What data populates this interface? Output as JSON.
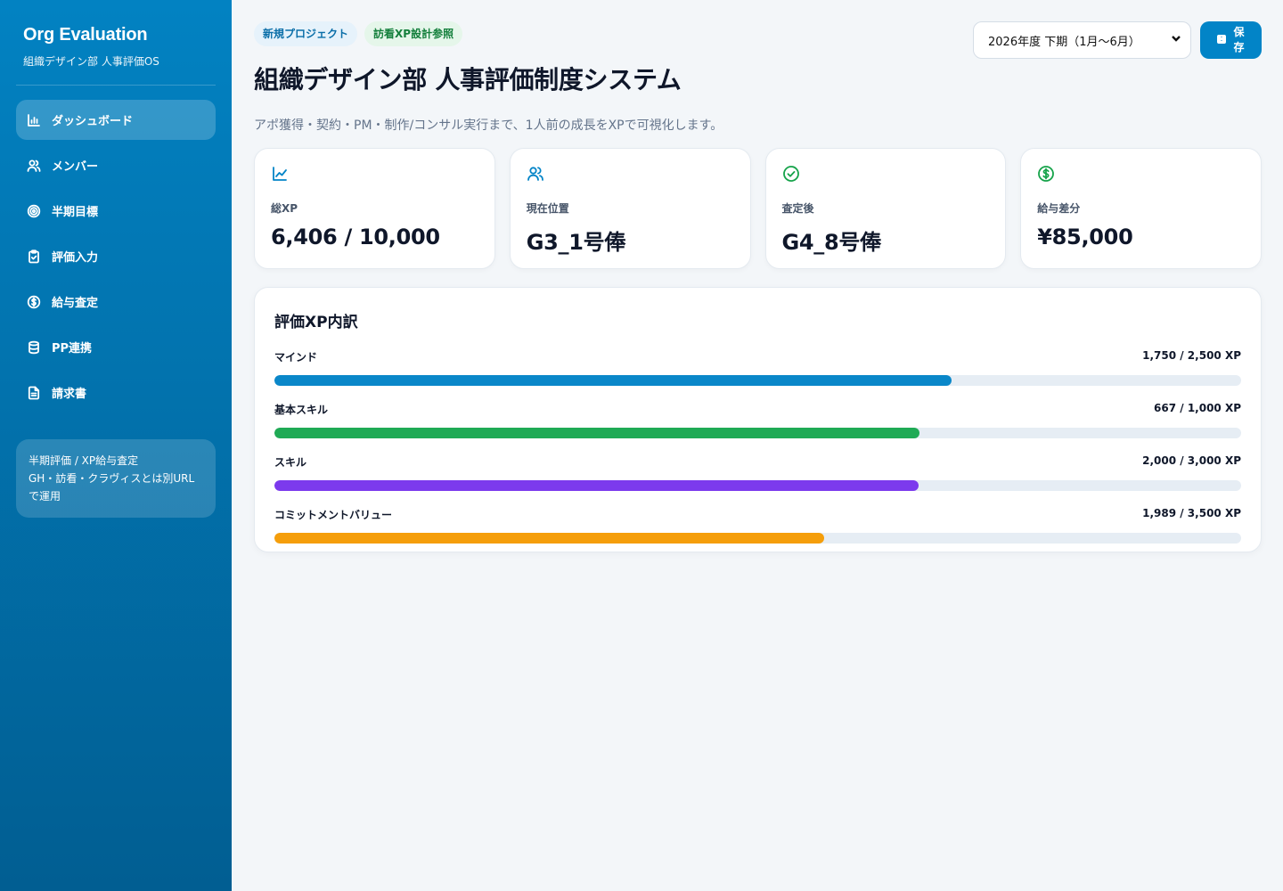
{
  "sidebar": {
    "brand_title": "Org Evaluation",
    "brand_subtitle": "組織デザイン部 人事評価OS",
    "items": [
      {
        "label": "ダッシュボード",
        "icon": "bar-chart-icon",
        "active": true
      },
      {
        "label": "メンバー",
        "icon": "users-icon"
      },
      {
        "label": "半期目標",
        "icon": "target-icon"
      },
      {
        "label": "評価入力",
        "icon": "clipboard-icon"
      },
      {
        "label": "給与査定",
        "icon": "dollar-circle-icon"
      },
      {
        "label": "PP連携",
        "icon": "database-icon"
      },
      {
        "label": "請求書",
        "icon": "document-icon"
      }
    ],
    "note_line1": "半期評価 / XP給与査定",
    "note_line2": "GH・訪看・クラヴィスとは別URLで運用"
  },
  "header": {
    "tags": [
      "新規プロジェクト",
      "訪看XP設計参照"
    ],
    "title": "組織デザイン部 人事評価制度システム",
    "description": "アポ獲得・契約・PM・制作/コンサル実行まで、1人前の成長をXPで可視化します。",
    "period_selected": "2026年度 下期（1月〜6月）",
    "save_label": "保存"
  },
  "stats": [
    {
      "label": "総XP",
      "value": "6,406 / 10,000",
      "icon": "line-chart-icon",
      "color": "#0284c7"
    },
    {
      "label": "現在位置",
      "value": "G3_1号俸",
      "icon": "users-icon",
      "color": "#0284c7"
    },
    {
      "label": "査定後",
      "value": "G4_8号俸",
      "icon": "check-circle-icon",
      "color": "#16a34a"
    },
    {
      "label": "給与差分",
      "value": "¥85,000",
      "icon": "dollar-circle-icon",
      "color": "#16a34a"
    }
  ],
  "breakdown": {
    "title": "評価XP内訳",
    "rows": [
      {
        "label": "マインド",
        "value_text": "1,750 / 2,500 XP",
        "value": 1750,
        "max": 2500,
        "color": "#0a87c9"
      },
      {
        "label": "基本スキル",
        "value_text": "667 / 1,000 XP",
        "value": 667,
        "max": 1000,
        "color": "#1faa55"
      },
      {
        "label": "スキル",
        "value_text": "2,000 / 3,000 XP",
        "value": 2000,
        "max": 3000,
        "color": "#7c3aed"
      },
      {
        "label": "コミットメントバリュー",
        "value_text": "1,989 / 3,500 XP",
        "value": 1989,
        "max": 3500,
        "color": "#f59e0b"
      }
    ]
  }
}
